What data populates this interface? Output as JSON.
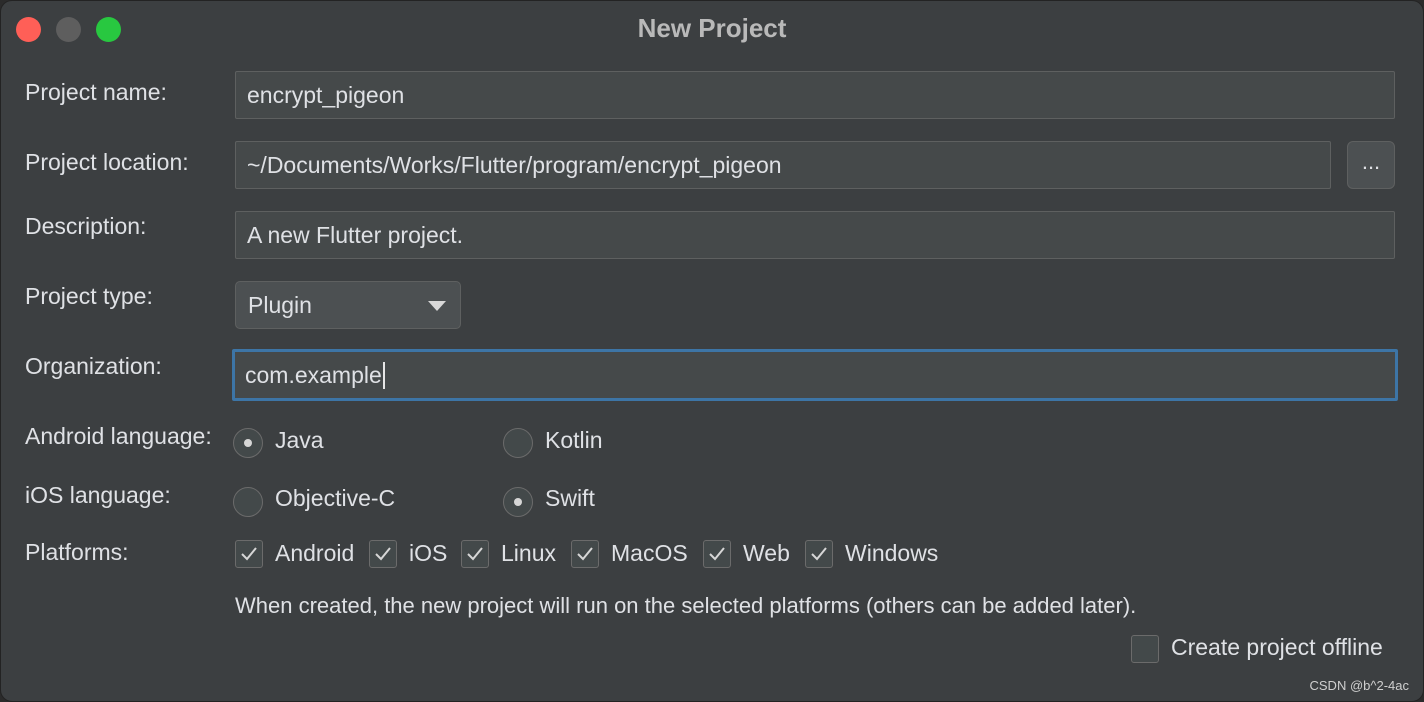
{
  "window": {
    "title": "New Project"
  },
  "form": {
    "project_name": {
      "label": "Project name:",
      "value": "encrypt_pigeon"
    },
    "project_location": {
      "label": "Project location:",
      "value": "~/Documents/Works/Flutter/program/encrypt_pigeon",
      "browse_label": "..."
    },
    "description": {
      "label": "Description:",
      "value": "A new Flutter project."
    },
    "project_type": {
      "label": "Project type:",
      "value": "Plugin"
    },
    "organization": {
      "label": "Organization:",
      "value": "com.example"
    },
    "android_language": {
      "label": "Android language:",
      "options": [
        {
          "label": "Java",
          "selected": true
        },
        {
          "label": "Kotlin",
          "selected": false
        }
      ]
    },
    "ios_language": {
      "label": "iOS language:",
      "options": [
        {
          "label": "Objective-C",
          "selected": false
        },
        {
          "label": "Swift",
          "selected": true
        }
      ]
    },
    "platforms": {
      "label": "Platforms:",
      "items": [
        {
          "label": "Android",
          "checked": true
        },
        {
          "label": "iOS",
          "checked": true
        },
        {
          "label": "Linux",
          "checked": true
        },
        {
          "label": "MacOS",
          "checked": true
        },
        {
          "label": "Web",
          "checked": true
        },
        {
          "label": "Windows",
          "checked": true
        }
      ],
      "hint": "When created, the new project will run on the selected platforms (others can be added later)."
    },
    "offline": {
      "label": "Create project offline",
      "checked": false
    }
  },
  "watermark": "CSDN @b^2-4ac",
  "colors": {
    "background": "#3c3f41",
    "field": "#45494a",
    "focus_border": "#3d75a6",
    "close": "#ff5f57",
    "maximize": "#28c840"
  }
}
